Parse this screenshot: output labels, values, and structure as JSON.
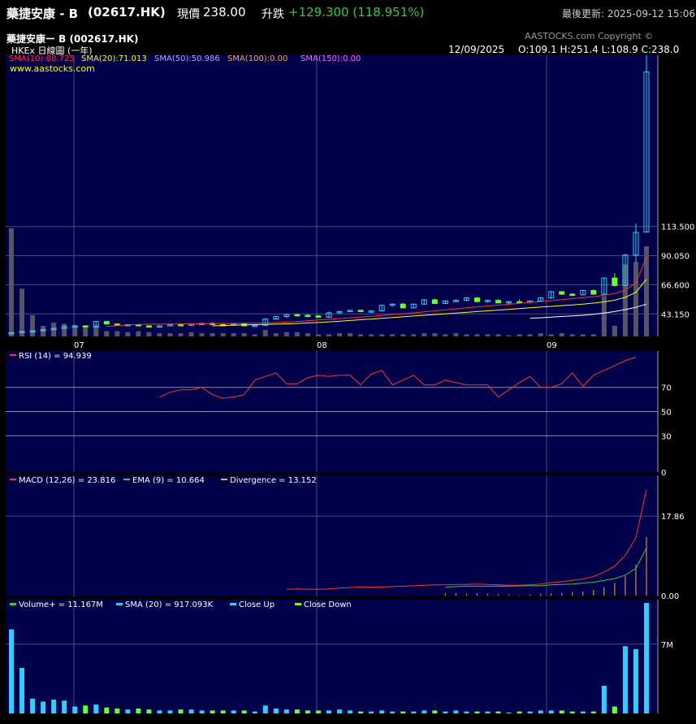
{
  "header": {
    "name": "藥捷安康 - B",
    "code": "(02617.HK)",
    "price_label": "現價",
    "price": "238.00",
    "change_label": "升跌",
    "change": "+129.300 (118.951%)",
    "updated": "最後更新: 2025-09-12 15:06"
  },
  "subheader": {
    "title": "藥捷安康ー B  (002617.HK)",
    "exchange": "HKEx  日線圖 (一年)",
    "copyright": "AASTOCKS.com Copyright ©",
    "date": "12/09/2025",
    "ohlc": "O:109.1  H:251.4  L:108.9  C:238.0",
    "website": "www.aastocks.com"
  },
  "colors": {
    "panel_bg": "#00004a",
    "grid": "#4a4a8a",
    "up": "#33ccff",
    "down": "#66ff33",
    "sma10": "#ff3333",
    "sma20": "#ffff00",
    "sma50": "#ffffff",
    "rsi": "#ff3333",
    "macd": "#ff3333",
    "ema": "#33cc33",
    "divergence": "#ffaa33",
    "volume_bar": "#556"
  },
  "chart_data": [
    {
      "type": "candlestick",
      "panel": "price",
      "legend": [
        {
          "text": "SMA(10):88.725",
          "color": "#ff3333"
        },
        {
          "text": "SMA(20):71.013",
          "color": "#ffff00"
        },
        {
          "text": "SMA(50):50.986",
          "color": "#aaaaff"
        },
        {
          "text": "SMA(100):0.00",
          "color": "#ffaa33"
        },
        {
          "text": "SMA(150):0.00",
          "color": "#ff66ff"
        }
      ],
      "y_ticks": [
        "43.150",
        "66.600",
        "90.050",
        "113.500"
      ],
      "x_ticks": [
        "07",
        "08",
        "09"
      ],
      "ylim": [
        25,
        251.4
      ],
      "ohlc": [
        [
          27.0,
          28.5,
          26.5,
          28.0
        ],
        [
          28.0,
          29.5,
          27.5,
          29.0
        ],
        [
          29.0,
          30.0,
          28.0,
          29.5
        ],
        [
          29.5,
          31.0,
          29.0,
          30.5
        ],
        [
          30.5,
          32.0,
          30.0,
          31.5
        ],
        [
          31.5,
          33.5,
          31.0,
          33.0
        ],
        [
          33.0,
          34.5,
          32.0,
          33.5
        ],
        [
          33.5,
          34.0,
          31.5,
          32.5
        ],
        [
          32.5,
          37.5,
          32.0,
          37.0
        ],
        [
          37.0,
          37.5,
          34.5,
          35.0
        ],
        [
          35.0,
          35.5,
          33.5,
          34.0
        ],
        [
          34.0,
          35.0,
          33.0,
          34.5
        ],
        [
          34.5,
          35.0,
          33.0,
          33.5
        ],
        [
          33.5,
          34.0,
          32.5,
          33.0
        ],
        [
          33.0,
          34.0,
          32.0,
          33.5
        ],
        [
          33.5,
          35.0,
          33.0,
          34.5
        ],
        [
          34.5,
          35.5,
          33.5,
          34.0
        ],
        [
          34.0,
          35.5,
          33.5,
          35.0
        ],
        [
          35.0,
          36.0,
          34.5,
          35.5
        ],
        [
          35.5,
          36.5,
          34.0,
          34.5
        ],
        [
          34.5,
          35.0,
          33.5,
          34.0
        ],
        [
          34.0,
          35.5,
          33.5,
          35.0
        ],
        [
          35.0,
          35.5,
          33.0,
          33.5
        ],
        [
          33.5,
          34.5,
          32.5,
          34.0
        ],
        [
          34.0,
          39.5,
          33.5,
          39.0
        ],
        [
          39.0,
          41.5,
          38.5,
          41.0
        ],
        [
          41.0,
          43.0,
          40.0,
          42.5
        ],
        [
          42.5,
          43.5,
          41.0,
          42.0
        ],
        [
          42.0,
          43.0,
          40.5,
          41.5
        ],
        [
          41.5,
          42.5,
          40.0,
          40.5
        ],
        [
          40.5,
          45.0,
          40.0,
          44.0
        ],
        [
          44.0,
          45.5,
          43.0,
          45.0
        ],
        [
          45.0,
          46.5,
          44.5,
          46.0
        ],
        [
          46.0,
          46.5,
          44.5,
          45.0
        ],
        [
          45.0,
          46.0,
          44.0,
          45.5
        ],
        [
          45.5,
          50.5,
          45.0,
          50.0
        ],
        [
          50.0,
          51.5,
          49.0,
          51.0
        ],
        [
          51.0,
          52.0,
          47.5,
          48.0
        ],
        [
          48.0,
          51.5,
          47.5,
          51.0
        ],
        [
          51.0,
          55.0,
          50.5,
          54.5
        ],
        [
          54.5,
          55.5,
          51.0,
          51.5
        ],
        [
          51.5,
          54.0,
          51.0,
          53.5
        ],
        [
          53.5,
          55.0,
          52.5,
          54.0
        ],
        [
          54.0,
          56.5,
          53.5,
          56.0
        ],
        [
          56.0,
          56.5,
          52.5,
          53.0
        ],
        [
          53.0,
          54.5,
          52.0,
          54.0
        ],
        [
          54.0,
          55.0,
          51.5,
          52.0
        ],
        [
          52.0,
          53.5,
          51.0,
          53.0
        ],
        [
          53.0,
          55.0,
          52.0,
          52.5
        ],
        [
          52.5,
          54.0,
          51.5,
          53.5
        ],
        [
          53.5,
          56.5,
          53.0,
          56.0
        ],
        [
          56.0,
          61.5,
          55.5,
          61.0
        ],
        [
          61.0,
          61.5,
          58.5,
          59.0
        ],
        [
          59.0,
          60.0,
          57.5,
          58.5
        ],
        [
          58.5,
          62.5,
          58.0,
          62.0
        ],
        [
          62.0,
          63.0,
          58.5,
          59.0
        ],
        [
          59.0,
          72.5,
          58.5,
          72.0
        ],
        [
          72.0,
          76.0,
          65.0,
          66.0
        ],
        [
          66.0,
          91.5,
          65.5,
          90.5
        ],
        [
          90.5,
          116.0,
          84.0,
          108.7
        ],
        [
          109.1,
          251.4,
          108.9,
          238.0
        ]
      ],
      "sma10": [
        null,
        null,
        null,
        null,
        null,
        null,
        null,
        null,
        null,
        33.0,
        33.7,
        34.2,
        34.6,
        34.8,
        34.9,
        34.9,
        35.0,
        35.1,
        35.2,
        35.3,
        35.4,
        35.5,
        35.6,
        35.6,
        35.8,
        36.1,
        36.5,
        37.0,
        37.6,
        38.2,
        38.8,
        39.4,
        40.0,
        40.6,
        41.2,
        41.9,
        42.6,
        43.3,
        44.0,
        44.8,
        45.6,
        46.4,
        47.2,
        48.0,
        48.8,
        49.5,
        50.2,
        50.9,
        51.6,
        52.3,
        53.0,
        53.8,
        54.6,
        55.4,
        56.2,
        57.0,
        58.2,
        59.6,
        62.2,
        68.0,
        88.725
      ],
      "sma20": [
        null,
        null,
        null,
        null,
        null,
        null,
        null,
        null,
        null,
        null,
        null,
        null,
        null,
        null,
        null,
        null,
        null,
        null,
        null,
        33.5,
        33.8,
        34.1,
        34.3,
        34.5,
        34.7,
        34.9,
        35.1,
        35.4,
        35.8,
        36.2,
        36.7,
        37.2,
        37.8,
        38.4,
        39.0,
        39.6,
        40.2,
        40.8,
        41.4,
        42.0,
        42.6,
        43.2,
        43.8,
        44.4,
        45.0,
        45.6,
        46.2,
        46.8,
        47.4,
        48.0,
        48.6,
        49.2,
        49.8,
        50.4,
        51.0,
        51.8,
        52.8,
        54.2,
        56.5,
        60.5,
        71.013
      ],
      "sma50": [
        null,
        null,
        null,
        null,
        null,
        null,
        null,
        null,
        null,
        null,
        null,
        null,
        null,
        null,
        null,
        null,
        null,
        null,
        null,
        null,
        null,
        null,
        null,
        null,
        null,
        null,
        null,
        null,
        null,
        null,
        null,
        null,
        null,
        null,
        null,
        null,
        null,
        null,
        null,
        null,
        null,
        null,
        null,
        null,
        null,
        null,
        null,
        null,
        null,
        39.5,
        40.0,
        40.5,
        41.0,
        41.5,
        42.0,
        42.8,
        43.8,
        45.0,
        46.6,
        48.4,
        50.986
      ],
      "volume_overlay": [
        10.2,
        4.5,
        2.0,
        1.0,
        1.3,
        1.2,
        1.0,
        0.8,
        1.1,
        0.5,
        0.5,
        0.4,
        0.5,
        0.4,
        0.3,
        0.3,
        0.3,
        0.4,
        0.3,
        0.3,
        0.3,
        0.3,
        0.3,
        0.2,
        0.6,
        0.3,
        0.4,
        0.4,
        0.3,
        0.2,
        0.2,
        0.3,
        0.3,
        0.2,
        0.2,
        0.2,
        0.2,
        0.2,
        0.2,
        0.3,
        0.3,
        0.2,
        0.3,
        0.2,
        0.2,
        0.2,
        0.2,
        0.1,
        0.2,
        0.2,
        0.3,
        0.2,
        0.3,
        0.2,
        0.2,
        0.2,
        3.8,
        1.0,
        6.8,
        7.0,
        8.5
      ]
    },
    {
      "type": "line",
      "panel": "rsi",
      "legend": [
        {
          "text": "RSI (14)  = 94.939",
          "color": "#ff3333"
        }
      ],
      "y_ticks": [
        "0",
        "30",
        "50",
        "70"
      ],
      "ylim": [
        0,
        100
      ],
      "values": [
        null,
        null,
        null,
        null,
        null,
        null,
        null,
        null,
        null,
        null,
        null,
        null,
        null,
        null,
        62,
        66,
        68,
        68,
        70,
        64,
        61,
        62,
        64,
        76,
        79,
        82,
        73,
        73,
        78,
        80,
        79,
        80,
        80,
        72,
        81,
        84,
        72,
        76,
        80,
        72,
        72,
        76,
        74,
        72,
        72,
        72,
        62,
        68,
        74,
        79,
        70,
        70,
        73,
        82,
        71,
        80,
        84,
        88,
        92,
        94.939
      ]
    },
    {
      "type": "line",
      "panel": "macd",
      "legend": [
        {
          "text": "MACD (12,26) = 23.816",
          "color": "#ff3333"
        },
        {
          "text": "EMA (9) = 10.664",
          "color": "#33cc33"
        },
        {
          "text": "Divergence = 13.152",
          "color": "#ffaa33"
        }
      ],
      "y_ticks": [
        "0.00",
        "17.86"
      ],
      "ylim": [
        -0.2,
        27
      ],
      "macd": [
        null,
        null,
        null,
        null,
        null,
        null,
        null,
        null,
        null,
        null,
        null,
        null,
        null,
        null,
        null,
        null,
        null,
        null,
        null,
        null,
        null,
        null,
        null,
        null,
        null,
        null,
        1.4,
        1.5,
        1.4,
        1.4,
        1.5,
        1.7,
        1.8,
        1.9,
        1.9,
        1.9,
        2.0,
        2.1,
        2.2,
        2.3,
        2.4,
        2.4,
        2.5,
        2.5,
        2.6,
        2.5,
        2.4,
        2.3,
        2.3,
        2.4,
        2.6,
        2.9,
        3.1,
        3.4,
        3.7,
        4.3,
        5.3,
        6.6,
        9.0,
        13.0,
        23.816
      ],
      "ema": [
        null,
        null,
        null,
        null,
        null,
        null,
        null,
        null,
        null,
        null,
        null,
        null,
        null,
        null,
        null,
        null,
        null,
        null,
        null,
        null,
        null,
        null,
        null,
        null,
        null,
        null,
        null,
        null,
        null,
        null,
        null,
        null,
        null,
        null,
        null,
        null,
        null,
        null,
        null,
        null,
        null,
        1.9,
        2.0,
        2.1,
        2.1,
        2.1,
        2.1,
        2.1,
        2.2,
        2.2,
        2.2,
        2.4,
        2.5,
        2.6,
        2.8,
        3.0,
        3.4,
        3.8,
        4.6,
        6.1,
        10.664
      ],
      "divergence": [
        null,
        null,
        null,
        null,
        null,
        null,
        null,
        null,
        null,
        null,
        null,
        null,
        null,
        null,
        null,
        null,
        null,
        null,
        null,
        null,
        null,
        null,
        null,
        null,
        null,
        null,
        null,
        null,
        null,
        null,
        null,
        null,
        null,
        null,
        null,
        null,
        null,
        null,
        null,
        null,
        null,
        0.5,
        0.5,
        0.4,
        0.5,
        0.4,
        0.3,
        0.2,
        0.1,
        0.2,
        0.4,
        0.5,
        0.6,
        0.8,
        0.9,
        1.3,
        1.9,
        2.8,
        4.4,
        6.9,
        13.152
      ]
    },
    {
      "type": "bar",
      "panel": "volume",
      "legend": [
        {
          "text": "Volume+ = 11.167M",
          "color": "#33cc33"
        },
        {
          "text": "SMA (20) = 917.093K",
          "color": "#33ccff"
        },
        {
          "text": "Close Up",
          "color": "#33ccff"
        },
        {
          "text": "Close Down",
          "color": "#66ff33"
        }
      ],
      "y_ticks": [
        "7M"
      ],
      "ylim": [
        0,
        11.5
      ],
      "values": [
        8.5,
        4.6,
        1.5,
        1.2,
        1.4,
        1.3,
        0.7,
        0.8,
        0.9,
        0.6,
        0.5,
        0.4,
        0.5,
        0.4,
        0.3,
        0.3,
        0.4,
        0.4,
        0.3,
        0.3,
        0.3,
        0.3,
        0.3,
        0.2,
        0.8,
        0.5,
        0.4,
        0.4,
        0.3,
        0.3,
        0.3,
        0.4,
        0.3,
        0.2,
        0.2,
        0.3,
        0.2,
        0.2,
        0.2,
        0.3,
        0.3,
        0.2,
        0.3,
        0.2,
        0.2,
        0.2,
        0.2,
        0.1,
        0.2,
        0.2,
        0.3,
        0.3,
        0.3,
        0.2,
        0.2,
        0.2,
        2.8,
        0.7,
        6.8,
        6.5,
        11.167
      ]
    }
  ]
}
